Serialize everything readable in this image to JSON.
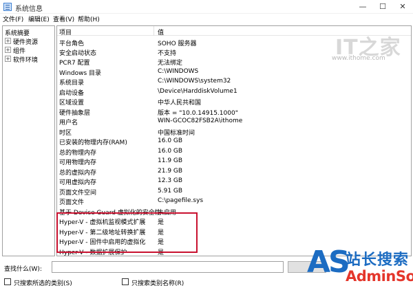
{
  "window": {
    "title": "系统信息",
    "controls": {
      "minimize": "—",
      "maximize": "☐",
      "close": "✕"
    }
  },
  "menu": [
    {
      "label": "文件(F)"
    },
    {
      "label": "编辑(E)"
    },
    {
      "label": "查看(V)"
    },
    {
      "label": "帮助(H)"
    }
  ],
  "tree": {
    "root": "系统摘要",
    "children": [
      {
        "label": "硬件资源",
        "expander": "+"
      },
      {
        "label": "组件",
        "expander": "+"
      },
      {
        "label": "软件环境",
        "expander": "+"
      }
    ]
  },
  "list": {
    "columns": {
      "item": "项目",
      "value": "值"
    },
    "rows": [
      {
        "item": "平台角色",
        "value": "SOHO 服务器"
      },
      {
        "item": "安全启动状态",
        "value": "不支持"
      },
      {
        "item": "PCR7 配置",
        "value": "无法绑定"
      },
      {
        "item": "Windows 目录",
        "value": "C:\\WINDOWS"
      },
      {
        "item": "系统目录",
        "value": "C:\\WINDOWS\\system32"
      },
      {
        "item": "启动设备",
        "value": "\\Device\\HarddiskVolume1"
      },
      {
        "item": "区域设置",
        "value": "中华人民共和国"
      },
      {
        "item": "硬件抽象层",
        "value": "版本 = \"10.0.14915.1000\""
      },
      {
        "item": "用户名",
        "value": "WIN-GCOC82FSB2A\\ithome"
      },
      {
        "item": "时区",
        "value": "中国标准时间"
      },
      {
        "item": "已安装的物理内存(RAM)",
        "value": "16.0 GB"
      },
      {
        "item": "总的物理内存",
        "value": "16.0 GB"
      },
      {
        "item": "可用物理内存",
        "value": "11.9 GB"
      },
      {
        "item": "总的虚拟内存",
        "value": "21.9 GB"
      },
      {
        "item": "可用虚拟内存",
        "value": "12.3 GB"
      },
      {
        "item": "页面文件空间",
        "value": "5.91 GB"
      },
      {
        "item": "页面文件",
        "value": "C:\\pagefile.sys"
      },
      {
        "item": "基于 Device Guard 虚拟化的安全性",
        "value": "未启用"
      },
      {
        "item": "Hyper-V - 虚拟机监视模式扩展",
        "value": "是"
      },
      {
        "item": "Hyper-V - 第二级地址转换扩展",
        "value": "是"
      },
      {
        "item": "Hyper-V - 固件中启用的虚拟化",
        "value": "是"
      },
      {
        "item": "Hyper-V - 数据扩展保护",
        "value": "是"
      }
    ]
  },
  "watermark": {
    "logo": "IT之家",
    "url": "www.ithome.com"
  },
  "search": {
    "label": "查找什么(W):",
    "value": "",
    "find_button": "",
    "option_selected": "只搜索所选的类别(S)",
    "option_names": "只搜索类别名称(R)"
  },
  "badge": {
    "mark": "AS",
    "cn": "站长搜索",
    "en": "AdminSo"
  },
  "colors": {
    "highlight_border": "#c8102e",
    "badge_blue": "#1c6cc2",
    "badge_red": "#e4362b"
  }
}
